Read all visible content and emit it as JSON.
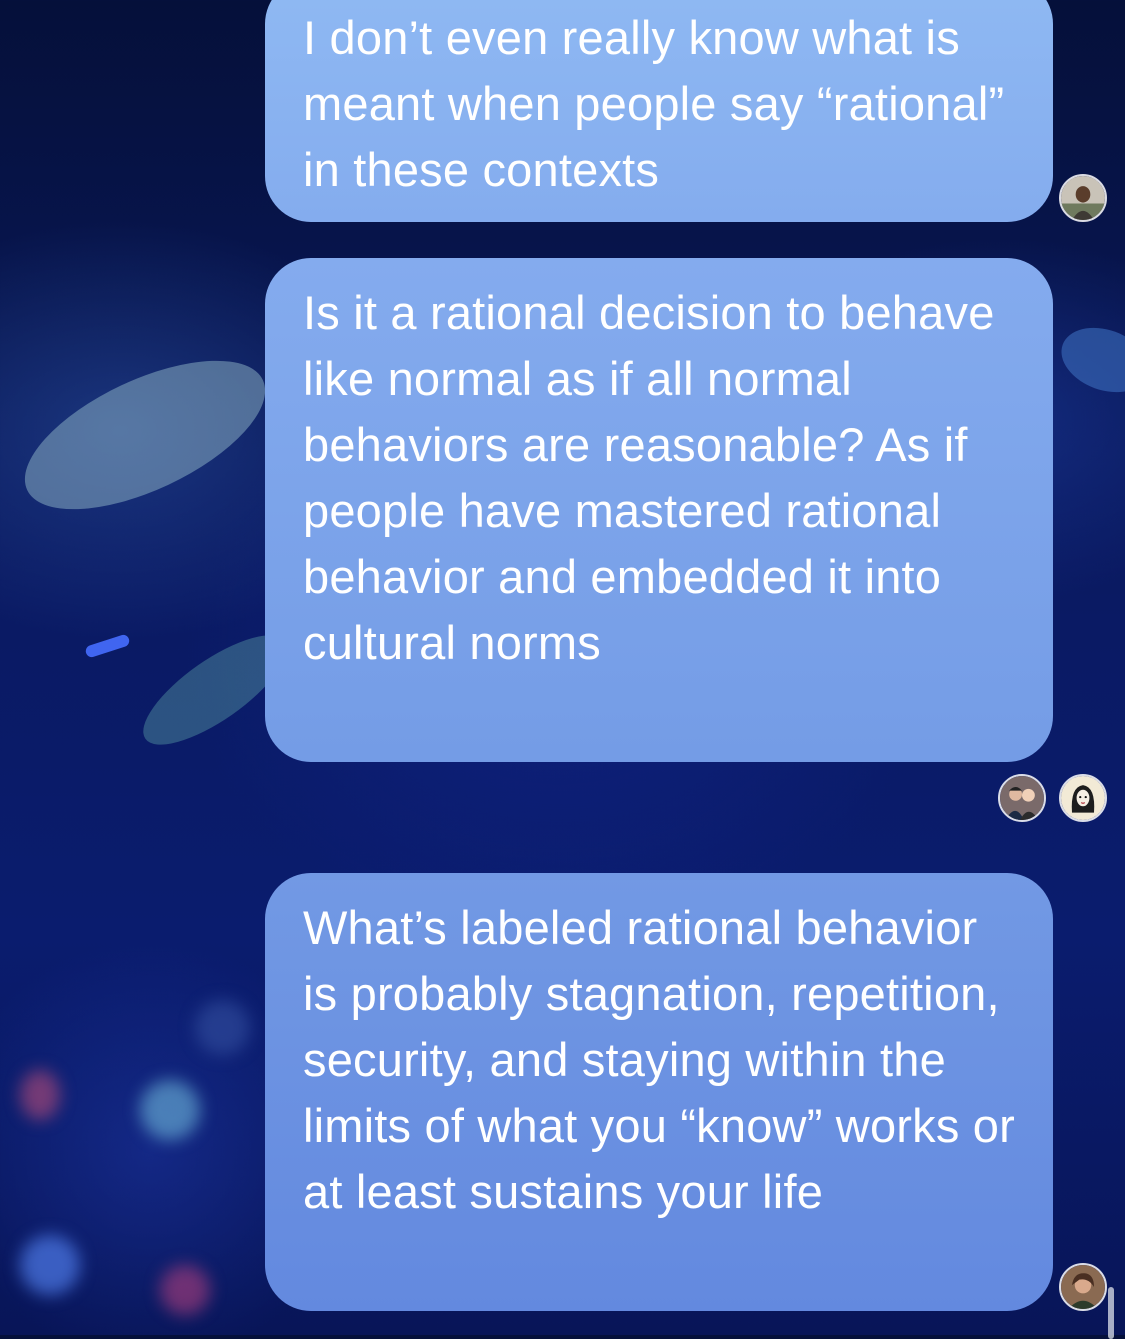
{
  "messages": [
    {
      "text": "I don’t even really know what is meant when people say “rational” in these contexts",
      "avatar": "avatar-man-icon"
    },
    {
      "text": "Is it a rational decision to behave like normal as if all normal behaviors are reasonable? As if people have mastered rational behavior and embedded it into cultural norms",
      "read_receipts": [
        "avatar-couple-icon",
        "avatar-woman-illustration-icon"
      ]
    },
    {
      "text": "What’s labeled rational behavior is probably stagnation, repetition, security, and staying within the limits of what you “know” works or at least sustains your life",
      "avatar": "avatar-person-icon"
    }
  ],
  "colors": {
    "bubble_top": "#8fb9f3",
    "bubble_bottom": "#6389df",
    "background": "#0a1a63"
  }
}
